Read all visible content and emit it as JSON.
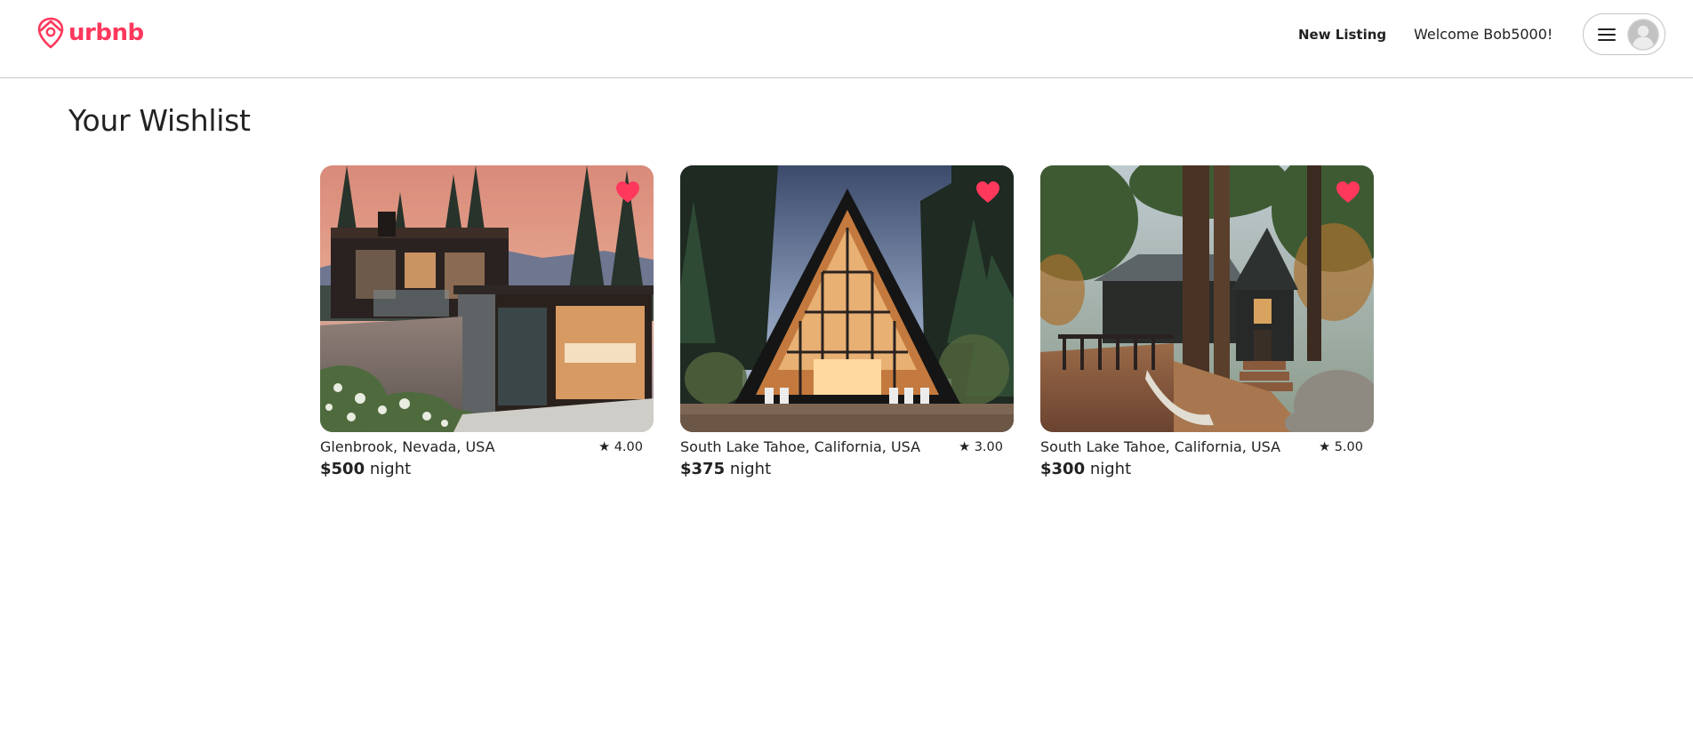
{
  "brand": {
    "name": "urbnb",
    "color": "#ff385c"
  },
  "header": {
    "new_listing": "New Listing",
    "welcome": "Welcome Bob5000!",
    "menu_icon": "hamburger-icon",
    "avatar_icon": "default-avatar-icon"
  },
  "page": {
    "title": "Your Wishlist"
  },
  "listings": [
    {
      "location": "Glenbrook, Nevada, USA",
      "rating": "★ 4.00",
      "price": "$500",
      "unit": "night",
      "favorited": true
    },
    {
      "location": "South Lake Tahoe, California, USA",
      "rating": "★ 3.00",
      "price": "$375",
      "unit": "night",
      "favorited": true
    },
    {
      "location": "South Lake Tahoe, California, USA",
      "rating": "★ 5.00",
      "price": "$300",
      "unit": "night",
      "favorited": true
    }
  ]
}
